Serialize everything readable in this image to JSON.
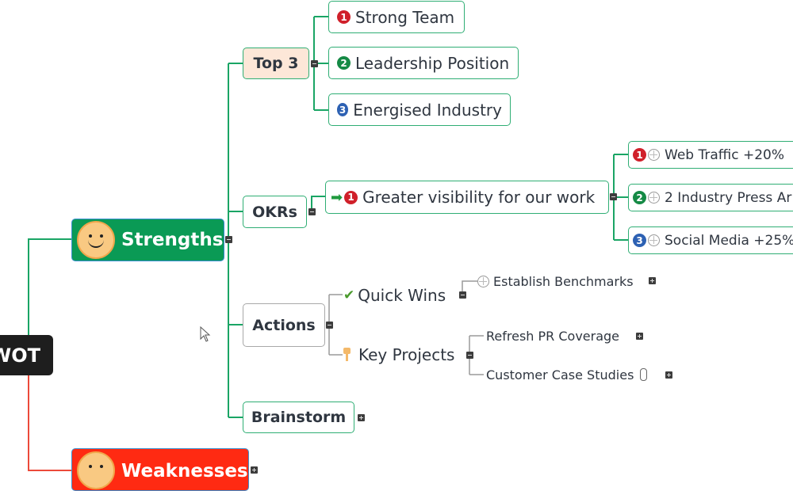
{
  "map": {
    "root": {
      "label": "WOT",
      "color": "#1e1e1e"
    },
    "main_topics": [
      {
        "label": "Strengths",
        "icon": "smiley-face-icon",
        "color": "#0a9a55",
        "collapsed": false
      },
      {
        "label": "Weaknesses",
        "icon": "neutral-face-icon",
        "color": "#ff2a12",
        "collapsed": true
      }
    ],
    "strengths": {
      "top3": {
        "label": "Top 3",
        "items": [
          {
            "priority": "1",
            "priority_color": "#d0202a",
            "label": "Strong Team"
          },
          {
            "priority": "2",
            "priority_color": "#158a45",
            "label": "Leadership Position"
          },
          {
            "priority": "3",
            "priority_color": "#2d61b3",
            "label": "Energised Industry"
          }
        ]
      },
      "okrs": {
        "label": "OKRs",
        "objective": {
          "icon": "green-arrow-icon",
          "priority": "1",
          "priority_color": "#d0202a",
          "label": "Greater visibility for our work"
        },
        "key_results": [
          {
            "priority": "1",
            "priority_color": "#d0202a",
            "icon": "target-icon",
            "label": "Web Traffic +20%"
          },
          {
            "priority": "2",
            "priority_color": "#158a45",
            "icon": "target-icon",
            "label": "2 Industry Press Ar"
          },
          {
            "priority": "3",
            "priority_color": "#2d61b3",
            "icon": "target-icon",
            "label": "Social Media +25%"
          }
        ]
      },
      "actions": {
        "label": "Actions",
        "quick_wins": {
          "icon": "check-icon",
          "label": "Quick Wins",
          "children": [
            {
              "icon": "target-icon",
              "label": "Establish Benchmarks",
              "collapsed": true
            }
          ]
        },
        "key_projects": {
          "icon": "key-icon",
          "label": "Key Projects",
          "children": [
            {
              "label": "Refresh PR Coverage",
              "collapsed": true
            },
            {
              "label": "Customer Case Studies",
              "attachment": true,
              "collapsed": true
            }
          ]
        }
      },
      "brainstorm": {
        "label": "Brainstorm",
        "collapsed": true
      }
    },
    "glyphs": {
      "check": "✔",
      "arrow": "➡",
      "key": "🔑",
      "paperclip": "📎"
    }
  }
}
